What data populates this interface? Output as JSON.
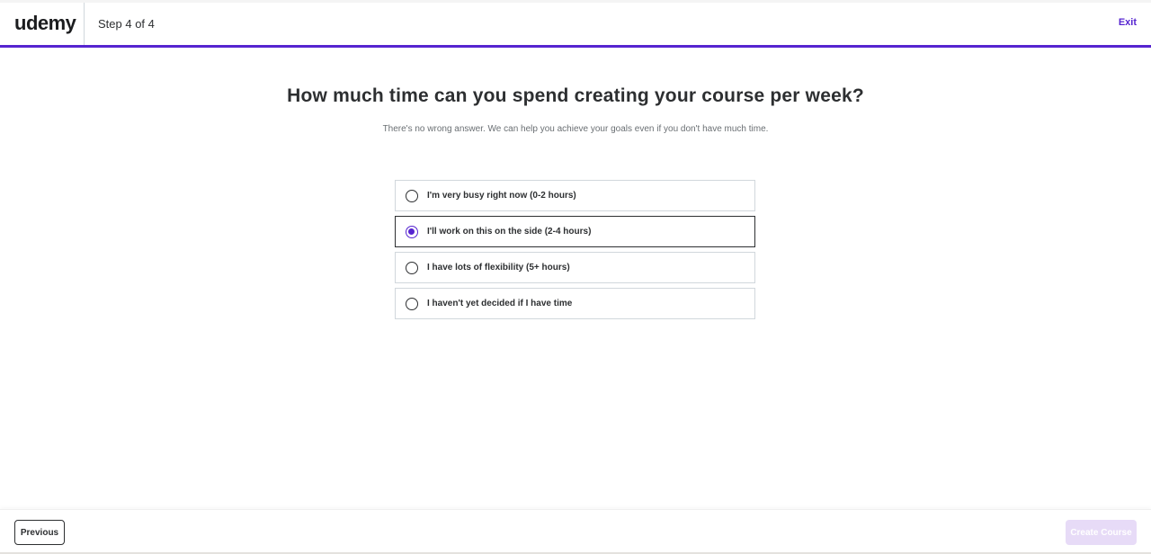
{
  "header": {
    "logo": "udemy",
    "step": "Step 4 of 4",
    "exit": "Exit"
  },
  "question": {
    "title": "How much time can you spend creating your course per week?",
    "subtitle": "There's no wrong answer. We can help you achieve your goals even if you don't have much time."
  },
  "options": [
    {
      "label": "I'm very busy right now (0-2 hours)",
      "selected": false
    },
    {
      "label": "I'll work on this on the side (2-4 hours)",
      "selected": true
    },
    {
      "label": "I have lots of flexibility (5+ hours)",
      "selected": false
    },
    {
      "label": "I haven't yet decided if I have time",
      "selected": false
    }
  ],
  "footer": {
    "previous": "Previous",
    "create": "Create Course"
  },
  "colors": {
    "brand": "#5624d0",
    "logo_accent": "#a435f0",
    "disabled_button": "#e7dbf7"
  }
}
